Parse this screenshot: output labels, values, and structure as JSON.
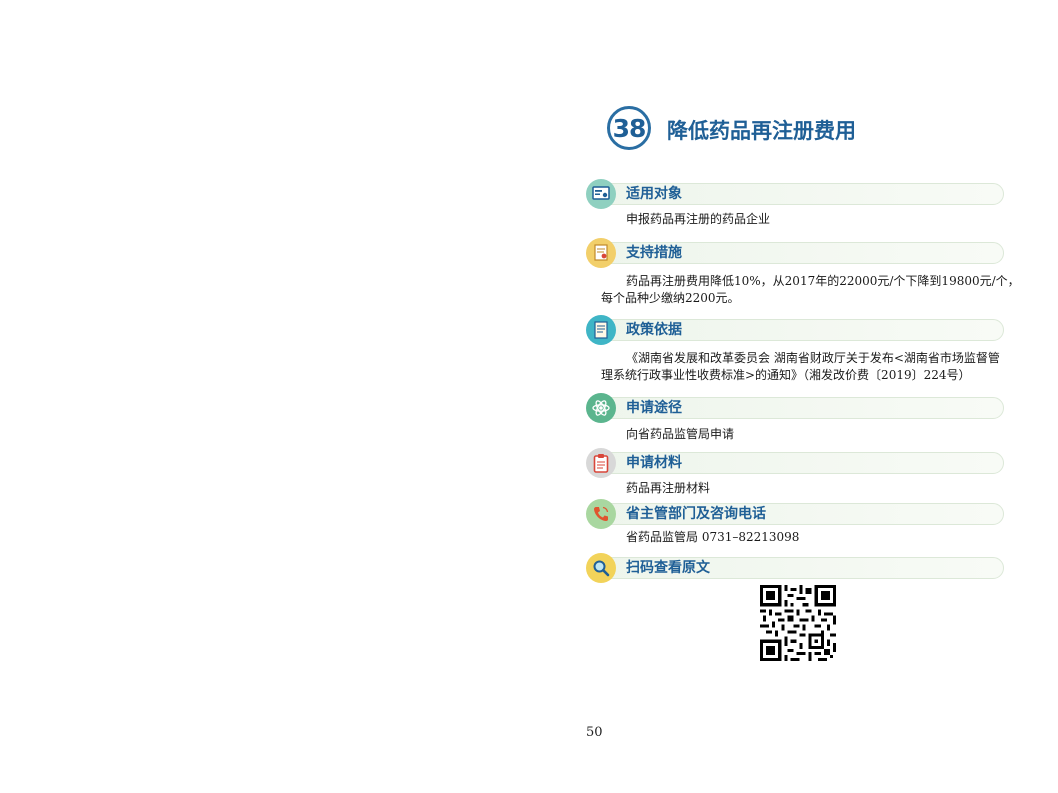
{
  "header": {
    "number": "38",
    "title": "降低药品再注册费用"
  },
  "sections": [
    {
      "title": "适用对象",
      "body": [
        "申报药品再注册的药品企业"
      ],
      "icon": "id-card-icon",
      "color": "#8fd0c0"
    },
    {
      "title": "支持措施",
      "body": [
        "药品再注册费用降低10%，从2017年的22000元/个下降到19800元/个，",
        "每个品种少缴纳2200元。"
      ],
      "icon": "certificate-icon",
      "color": "#f2cf6a"
    },
    {
      "title": "政策依据",
      "body": [
        "《湖南省发展和改革委员会 湖南省财政厅关于发布<湖南省市场监督管",
        "理系统行政事业性收费标准>的通知》（湘发改价费〔2019〕224号）"
      ],
      "icon": "document-icon",
      "color": "#3fb5c6"
    },
    {
      "title": "申请途径",
      "body": [
        "向省药品监管局申请"
      ],
      "icon": "atom-icon",
      "color": "#5bb58e"
    },
    {
      "title": "申请材料",
      "body": [
        "药品再注册材料"
      ],
      "icon": "clipboard-icon",
      "color": "#d8d8d8"
    },
    {
      "title": "省主管部门及咨询电话",
      "body": [
        "省药品监管局 0731–82213098"
      ],
      "icon": "phone-icon",
      "color": "#a9d7a0"
    },
    {
      "title": "扫码查看原文",
      "body": [],
      "icon": "magnifier-icon",
      "color": "#f2d35a"
    }
  ],
  "page_number": "50"
}
